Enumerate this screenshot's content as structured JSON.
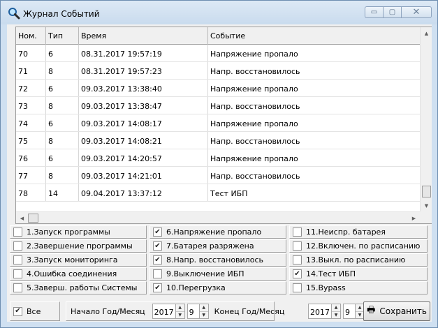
{
  "window": {
    "title": "Журнал Событий",
    "minimize_glyph": "▭",
    "maximize_glyph": "▢",
    "close_glyph": "✕"
  },
  "table": {
    "columns": [
      "Ном.",
      "Тип",
      "Время",
      "Событие"
    ],
    "rows": [
      [
        "70",
        "6",
        "08.31.2017 19:57:19",
        "Напряжение пропало"
      ],
      [
        "71",
        "8",
        "08.31.2017 19:57:23",
        "Напр. восстановилось"
      ],
      [
        "72",
        "6",
        "09.03.2017 13:38:40",
        "Напряжение пропало"
      ],
      [
        "73",
        "8",
        "09.03.2017 13:38:47",
        "Напр. восстановилось"
      ],
      [
        "74",
        "6",
        "09.03.2017 14:08:17",
        "Напряжение пропало"
      ],
      [
        "75",
        "8",
        "09.03.2017 14:08:21",
        "Напр. восстановилось"
      ],
      [
        "76",
        "6",
        "09.03.2017 14:20:57",
        "Напряжение пропало"
      ],
      [
        "77",
        "8",
        "09.03.2017 14:21:01",
        "Напр. восстановилось"
      ],
      [
        "78",
        "14",
        "09.04.2017 13:37:12",
        "Тест ИБП"
      ]
    ]
  },
  "filters": [
    {
      "label": "1.Запуск программы",
      "checked": false
    },
    {
      "label": "2.Завершение программы",
      "checked": false
    },
    {
      "label": "3.Запуск мониторинга",
      "checked": false
    },
    {
      "label": "4.Ошибка соединения",
      "checked": false
    },
    {
      "label": "5.Заверш. работы Системы",
      "checked": false
    },
    {
      "label": "6.Напряжение пропало",
      "checked": true
    },
    {
      "label": "7.Батарея разряжена",
      "checked": true
    },
    {
      "label": "8.Напр. восстановилось",
      "checked": true
    },
    {
      "label": "9.Выключение ИБП",
      "checked": false
    },
    {
      "label": "10.Перегрузка",
      "checked": true
    },
    {
      "label": "11.Неиспр. батарея",
      "checked": false
    },
    {
      "label": "12.Включен. по расписанию",
      "checked": false
    },
    {
      "label": "13.Выкл. по расписанию",
      "checked": false
    },
    {
      "label": "14.Тест ИБП",
      "checked": true
    },
    {
      "label": "15.Bypass",
      "checked": false
    }
  ],
  "bottom": {
    "all_label": "Все",
    "all_checked": true,
    "start_label": "Начало Год/Месяц",
    "start_year": "2017",
    "start_month": "9",
    "end_label": "Конец Год/Месяц",
    "end_year": "2017",
    "end_month": "9",
    "save_label": "Сохранить"
  }
}
